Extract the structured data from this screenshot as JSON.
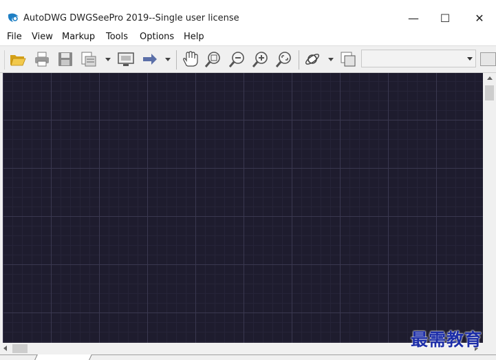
{
  "window": {
    "title": "AutoDWG DWGSeePro 2019--Single user license",
    "minimize_label": "—",
    "maximize_label": "☐",
    "close_label": "✕"
  },
  "menu": {
    "items": [
      {
        "label": "File"
      },
      {
        "label": "View"
      },
      {
        "label": "Markup"
      },
      {
        "label": "Tools"
      },
      {
        "label": "Options"
      },
      {
        "label": "Help"
      }
    ]
  },
  "toolbar": {
    "icons": [
      "open-folder-icon",
      "print-icon",
      "save-icon",
      "convert-icon",
      "monitor-icon",
      "arrow-right-icon",
      "pan-hand-icon",
      "zoom-window-icon",
      "zoom-out-icon",
      "zoom-in-icon",
      "zoom-fit-icon",
      "orbit-icon",
      "layers-icon"
    ],
    "combo_value": ""
  },
  "colors": {
    "canvas_background": "#1e1c2e",
    "grid_major": "#3a3850",
    "grid_minor": "#262438",
    "watermark": "#1d2ea8"
  },
  "watermark": {
    "text": "最需教育"
  }
}
